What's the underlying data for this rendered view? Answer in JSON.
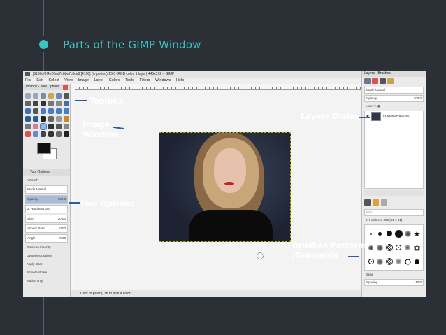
{
  "slide": {
    "title": "Parts of the GIMP Window"
  },
  "gimp": {
    "window_title": "[5190df0f4e26ed7c6be7c0ce8 [4108] (imported)-15.0 (RGB color, 1 layer) 445x372 – GIMP",
    "menu": [
      "File",
      "Edit",
      "Select",
      "View",
      "Image",
      "Layer",
      "Colors",
      "Tools",
      "Filters",
      "Windows",
      "Help"
    ],
    "toolbox": {
      "title": "Toolbox - Tool Options",
      "tool_options_tab": "Tool Options",
      "tool_name": "Airbrush",
      "mode_label": "Mode",
      "mode_value": "Normal",
      "opacity_label": "Opacity",
      "opacity_value": "100.0",
      "brush_label": "Brush",
      "brush_value": "2. Hardness 050",
      "size_label": "Size",
      "size_value": "20.00",
      "aspect_label": "Aspect Ratio",
      "aspect_value": "0.00",
      "angle_label": "Angle",
      "angle_value": "0.00",
      "dynamics_label": "Dynamics",
      "dynamics_value": "Pressure Opacity",
      "dynamics_options": "Dynamics Options",
      "apply_jitter": "Apply Jitter",
      "smooth_stroke": "Smooth stroke",
      "motion_only": "Motion only"
    },
    "status_text": "Click to paint (Ctrl to pick a color)",
    "layers": {
      "title": "Layers - Brushes",
      "mode_label": "Mode",
      "mode_value": "Normal",
      "opacity_label": "Opacity",
      "opacity_value": "100.0",
      "lock_label": "Lock:",
      "layer_name": "5190df0ef29eb26e",
      "filter_placeholder": "filter",
      "brush_name": "2. Hardness 050 (51 × 51)",
      "tags_label": "Basic",
      "spacing_label": "Spacing",
      "spacing_value": "10.0"
    }
  },
  "annotations": {
    "toolbox": "Toolbox",
    "image_window_line1": "Image",
    "image_window_line2": "Window",
    "layers_dialog": "Layers Dialog",
    "tool_options": "Tool Options",
    "brushes_line1": "Brushes/Patterns",
    "brushes_line2": "/Gradients"
  },
  "colors": {
    "slide_bg": "#2b2f36",
    "accent": "#3fc1c0",
    "pointer": "#2f5e9c"
  }
}
